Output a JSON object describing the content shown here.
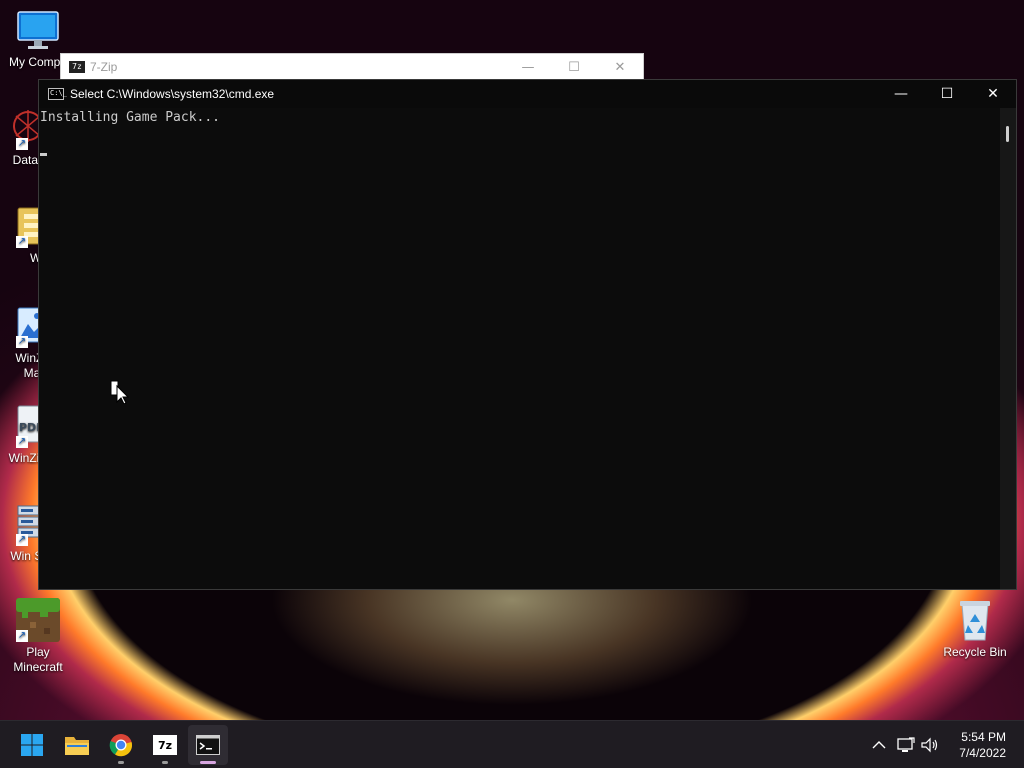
{
  "desktop": {
    "icons": [
      {
        "label": "My Compu"
      },
      {
        "label": "DataW"
      },
      {
        "label": "Wir"
      },
      {
        "label": "WinZip Mar"
      },
      {
        "label": "WinZi Exp"
      },
      {
        "label": "Win Secu"
      },
      {
        "label": "Play Minecraft"
      },
      {
        "label": "Recycle Bin"
      }
    ]
  },
  "zip_window": {
    "title": "7-Zip",
    "badge": "7z"
  },
  "cmd_window": {
    "title": "Select C:\\Windows\\system32\\cmd.exe",
    "icon_text": "C:\\_",
    "output": "Installing Game Pack...",
    "controls": {
      "minimize": "—",
      "maximize": "☐",
      "close": "✕"
    }
  },
  "taskbar": {
    "apps": [
      {
        "name": "start",
        "icon": "windows-logo-icon",
        "running": false
      },
      {
        "name": "file-explorer",
        "icon": "folder-icon",
        "running": false
      },
      {
        "name": "chrome",
        "icon": "chrome-icon",
        "running": true
      },
      {
        "name": "7-zip",
        "icon": "7zip-icon",
        "running": true,
        "badge": "7z"
      },
      {
        "name": "cmd",
        "icon": "terminal-icon",
        "running": true,
        "active": true
      }
    ],
    "tray": {
      "chevron": "^",
      "time": "5:54 PM",
      "date": "7/4/2022"
    }
  },
  "colors": {
    "console_bg": "#0c0c0c",
    "console_text": "#cccccc",
    "taskbar_bg": "#1f1c22",
    "active_indicator": "#d7a6e0"
  }
}
